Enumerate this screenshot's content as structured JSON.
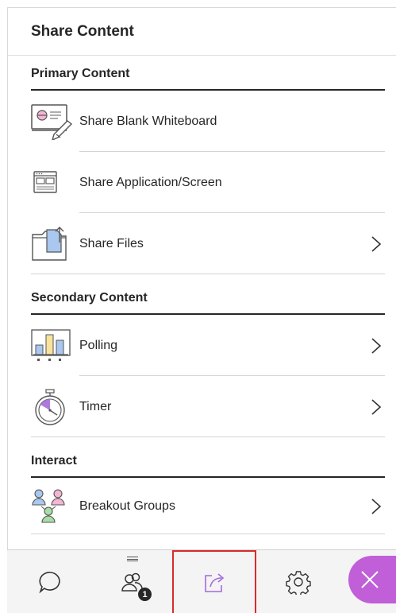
{
  "panel": {
    "title": "Share Content"
  },
  "sections": {
    "primary": {
      "title": "Primary Content",
      "items": [
        {
          "label": "Share Blank Whiteboard",
          "icon": "whiteboard-icon",
          "has_chevron": false
        },
        {
          "label": "Share Application/Screen",
          "icon": "application-screen-icon",
          "has_chevron": false
        },
        {
          "label": "Share Files",
          "icon": "files-folder-icon",
          "has_chevron": true
        }
      ]
    },
    "secondary": {
      "title": "Secondary Content",
      "items": [
        {
          "label": "Polling",
          "icon": "polling-chart-icon",
          "has_chevron": true
        },
        {
          "label": "Timer",
          "icon": "stopwatch-icon",
          "has_chevron": true
        }
      ]
    },
    "interact": {
      "title": "Interact",
      "items": [
        {
          "label": "Breakout Groups",
          "icon": "breakout-groups-icon",
          "has_chevron": true
        }
      ]
    }
  },
  "bottom_bar": {
    "tabs": [
      {
        "name": "chat",
        "icon": "chat-bubble-icon"
      },
      {
        "name": "attendees",
        "icon": "attendees-icon",
        "badge": "1"
      },
      {
        "name": "share-content",
        "icon": "share-content-icon",
        "active": true
      },
      {
        "name": "settings",
        "icon": "gear-icon"
      }
    ],
    "close": {
      "icon": "close-icon"
    }
  },
  "colors": {
    "accent_purple": "#c05fd8",
    "active_tab_border": "#d92b2b",
    "text": "#262626",
    "icon_lavender": "#a56ad8",
    "icon_green": "#a8dca8",
    "icon_pink": "#f3b6d4",
    "icon_blue": "#a9c7ef",
    "icon_yellow": "#f7e39a"
  }
}
